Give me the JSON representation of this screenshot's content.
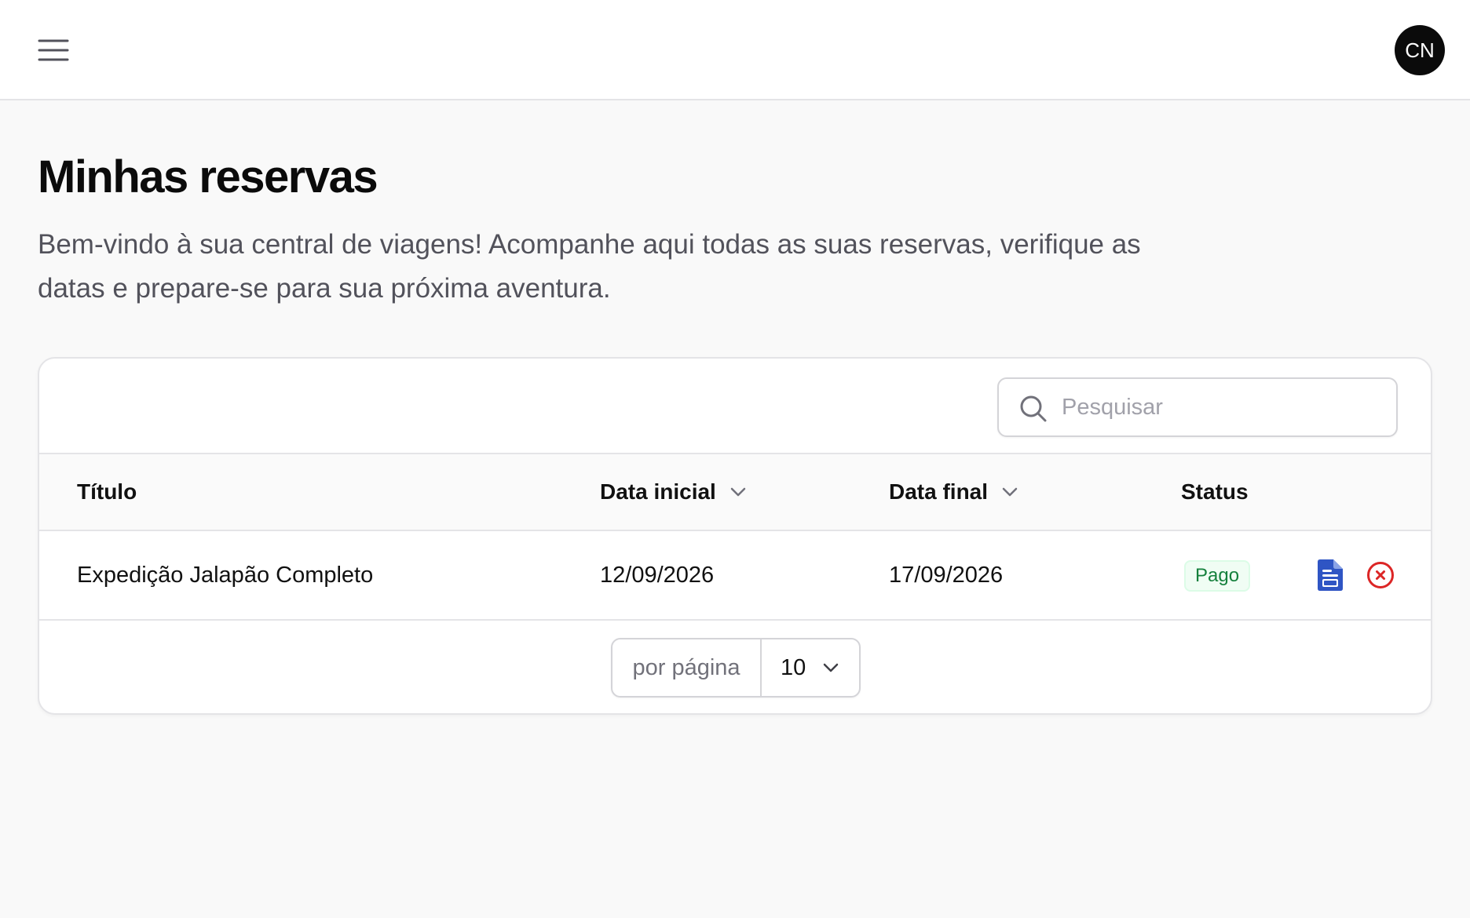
{
  "header": {
    "menu_icon": "menu-icon",
    "avatar_initials": "CN"
  },
  "page": {
    "title": "Minhas reservas",
    "description": "Bem-vindo à sua central de viagens! Acompanhe aqui todas as suas reservas, verifique as datas e prepare-se para sua próxima aventura."
  },
  "search": {
    "placeholder": "Pesquisar",
    "value": "",
    "icon": "search-icon"
  },
  "table": {
    "columns": [
      {
        "label": "Título",
        "sortable": false
      },
      {
        "label": "Data inicial",
        "sortable": true
      },
      {
        "label": "Data final",
        "sortable": true
      },
      {
        "label": "Status",
        "sortable": false
      }
    ],
    "rows": [
      {
        "title": "Expedição Jalapão Completo",
        "start_date": "12/09/2026",
        "end_date": "17/09/2026",
        "status": "Pago",
        "actions": [
          "document-icon",
          "cancel-icon"
        ]
      }
    ]
  },
  "pagination": {
    "per_page_label": "por página",
    "per_page_value": "10"
  },
  "colors": {
    "status_paid_text": "#15803d",
    "status_paid_bg": "#f0fdf4",
    "document_icon": "#2f55c4",
    "cancel_icon": "#dc2626",
    "avatar_bg": "#0b0b0b"
  }
}
